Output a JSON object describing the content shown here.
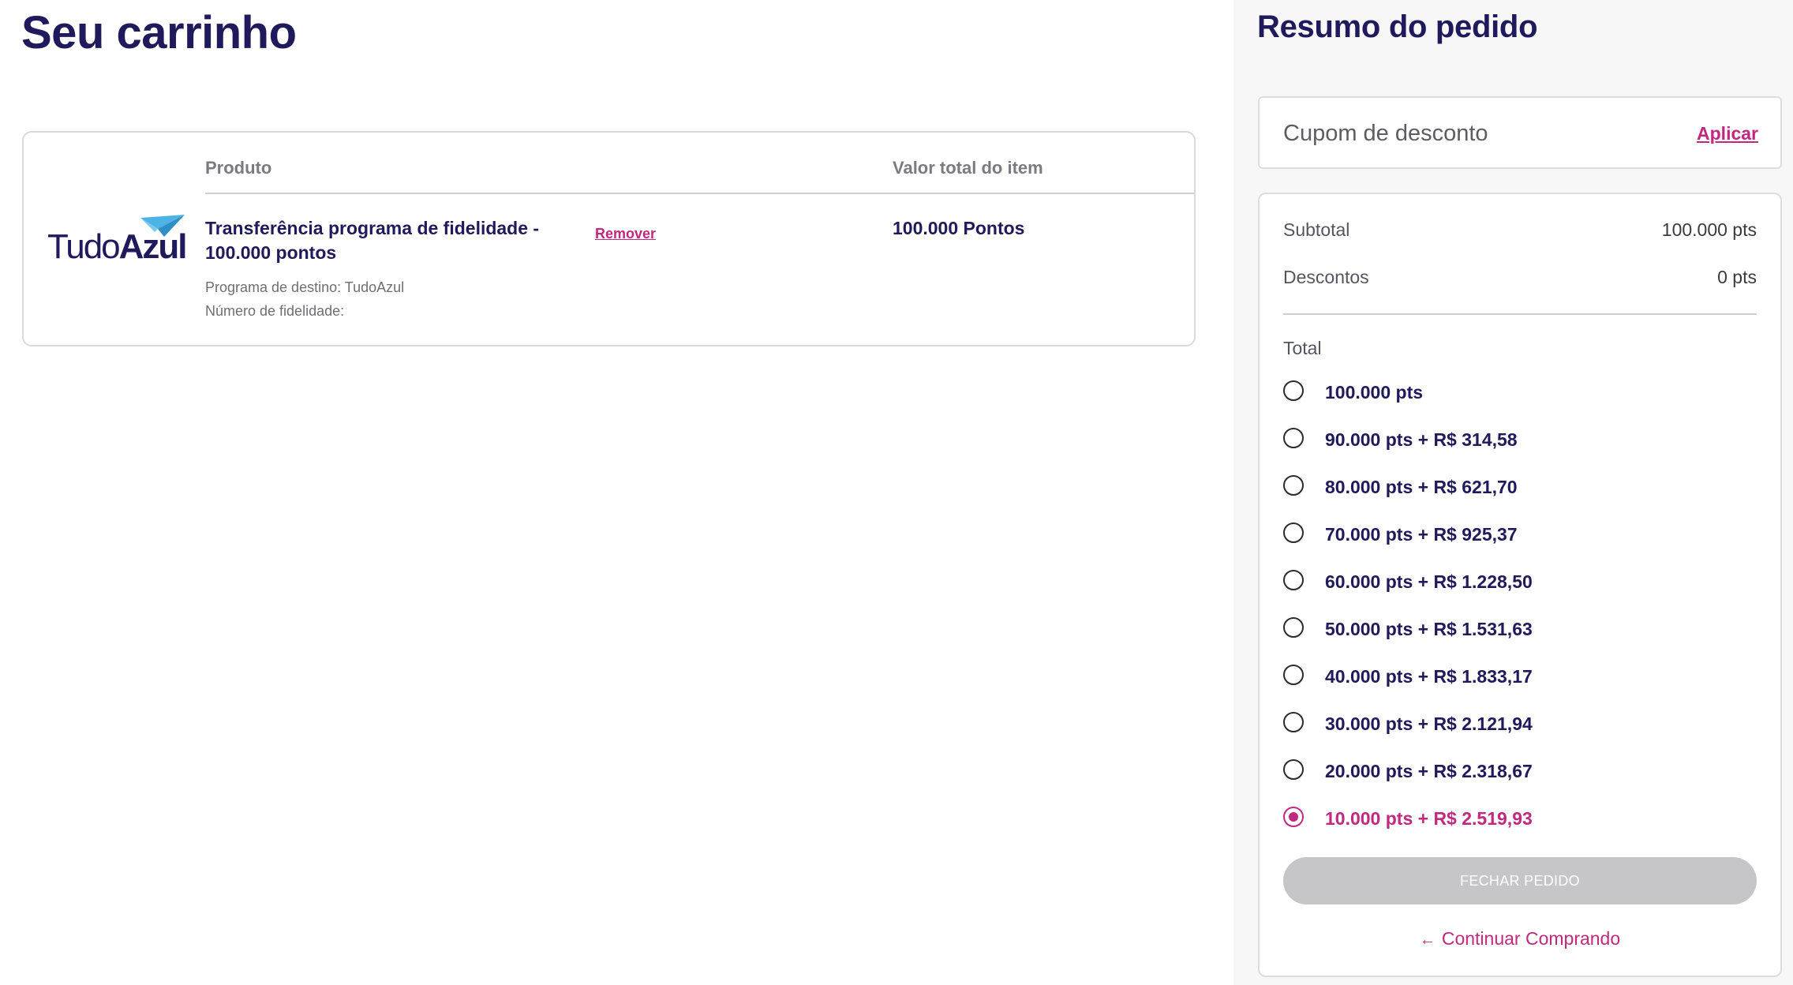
{
  "cart": {
    "title": "Seu carrinho",
    "columns": {
      "product": "Produto",
      "total": "Valor total do item"
    },
    "item": {
      "logo": {
        "text_light": "Tudo",
        "text_bold": "Azul",
        "icon": "paper-plane-icon"
      },
      "name": "Transferência programa de fidelidade - 100.000 pontos",
      "remove_label": "Remover",
      "total": "100.000 Pontos",
      "destination": "Programa de destino: TudoAzul",
      "loyalty_number": "Número de fidelidade:"
    }
  },
  "summary": {
    "title": "Resumo do pedido",
    "coupon": {
      "placeholder": "Cupom de desconto",
      "apply_label": "Aplicar"
    },
    "subtotal": {
      "label": "Subtotal",
      "value": "100.000 pts"
    },
    "discounts": {
      "label": "Descontos",
      "value": "0 pts"
    },
    "total_label": "Total",
    "options": [
      {
        "label": "100.000 pts",
        "selected": false
      },
      {
        "label": "90.000 pts + R$ 314,58",
        "selected": false
      },
      {
        "label": "80.000 pts + R$ 621,70",
        "selected": false
      },
      {
        "label": "70.000 pts + R$ 925,37",
        "selected": false
      },
      {
        "label": "60.000 pts + R$ 1.228,50",
        "selected": false
      },
      {
        "label": "50.000 pts + R$ 1.531,63",
        "selected": false
      },
      {
        "label": "40.000 pts + R$ 1.833,17",
        "selected": false
      },
      {
        "label": "30.000 pts + R$ 2.121,94",
        "selected": false
      },
      {
        "label": "20.000 pts + R$ 2.318,67",
        "selected": false
      },
      {
        "label": "10.000 pts + R$ 2.519,93",
        "selected": true
      }
    ],
    "checkout_label": "FECHAR PEDIDO",
    "continue_label": "Continuar Comprando",
    "continue_icon": "arrow-left-icon"
  },
  "colors": {
    "primary_text": "#1f1a5c",
    "accent": "#c2287e",
    "disabled_button": "#c6c6c9",
    "logo_blue": "#4db3e6"
  }
}
